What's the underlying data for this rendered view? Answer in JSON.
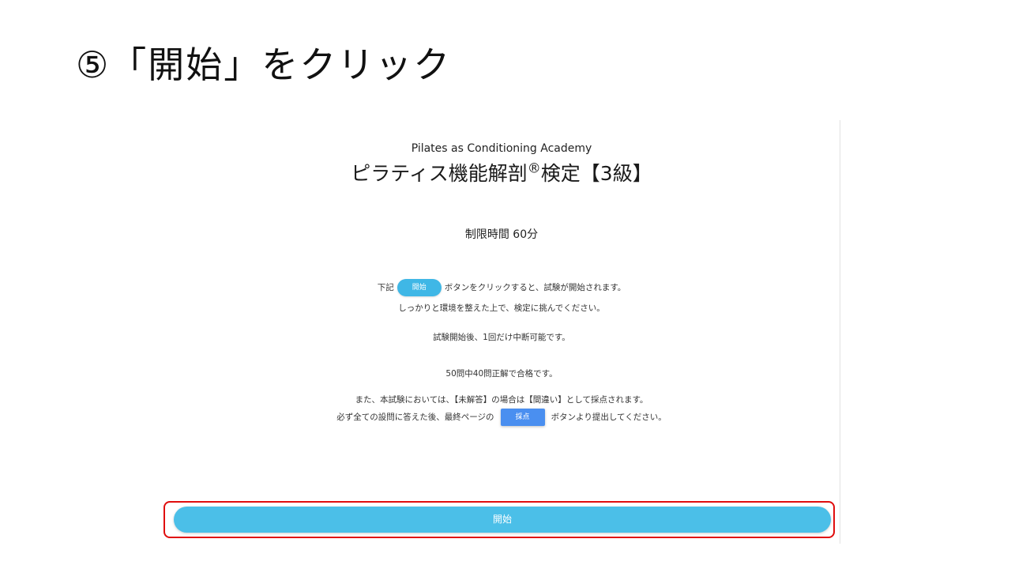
{
  "slide": {
    "title": "⑤「開始」をクリック"
  },
  "screen": {
    "academy": "Pilates as Conditioning Academy",
    "exam_title_before": "ピラティス機能解剖",
    "exam_title_mark": "®",
    "exam_title_after": "検定【3級】",
    "time_limit": "制限時間 60分",
    "instruction_prefix": "下記",
    "inline_start_label": "開始",
    "instruction_suffix": "ボタンをクリックすると、試験が開始されます。",
    "environment_note": "しっかりと環境を整えた上で、検定に挑んでください。",
    "pause_note": "試験開始後、1回だけ中断可能です。",
    "pass_note": "50問中40問正解で合格です。",
    "unanswered_note": "また、本試験においては、【未解答】の場合は【間違い】として採点されます。",
    "submit_prefix": "必ず全ての設問に答えた後、最終ページの",
    "inline_score_label": "採点",
    "submit_suffix": "ボタンより提出してください。",
    "start_button": "開始"
  },
  "colors": {
    "accent": "#4bbfe8",
    "score_button": "#4a8ff0",
    "highlight": "#e00d0d"
  }
}
